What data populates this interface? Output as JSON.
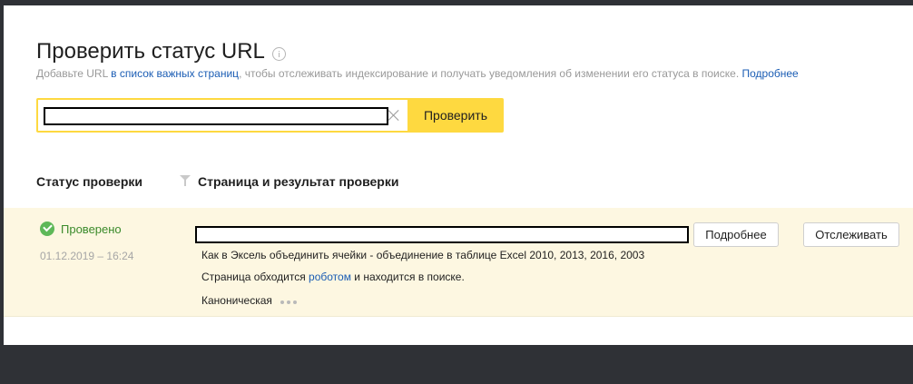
{
  "header": {
    "title": "Проверить статус URL",
    "subtitle_before": "Добавьте URL ",
    "subtitle_link": "в список важных страниц",
    "subtitle_after": ", чтобы отслеживать индексирование и получать уведомления об изменении его статуса в поиске. ",
    "subtitle_more_link": "Подробнее"
  },
  "search": {
    "value": "",
    "button_label": "Проверить"
  },
  "columns": {
    "status": "Статус проверки",
    "page": "Страница и результат проверки"
  },
  "results": [
    {
      "status": "Проверено",
      "datetime": "01.12.2019 – 16:24",
      "page_title": "Как в Эксель объединить ячейки - объединение в таблице Excel 2010, 2013, 2016, 2003",
      "desc_before": "Страница обходится ",
      "desc_link": "роботом",
      "desc_after": " и находится в поиске.",
      "canonical_label": "Каноническая",
      "more_button": "Подробнее",
      "track_button": "Отслеживать"
    }
  ],
  "colors": {
    "accent": "#fed940",
    "link": "#1b5db4",
    "success": "#5eb858",
    "row_highlight": "#fdf7e1"
  },
  "icons": [
    "info-icon",
    "clear-icon",
    "filter-icon",
    "checkmark-circle-icon",
    "more-dots-icon"
  ]
}
